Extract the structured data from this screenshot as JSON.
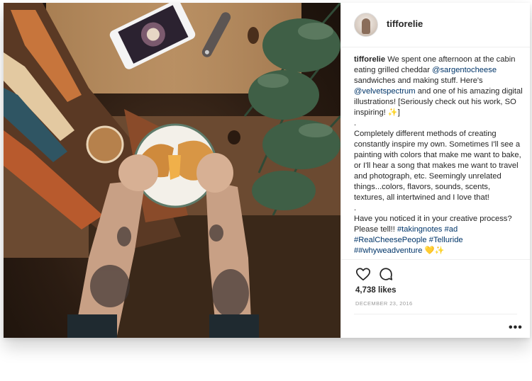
{
  "post": {
    "username": "tifforelie",
    "caption": {
      "username": "tifforelie",
      "seg1": " We spent one afternoon at the cabin eating grilled cheddar ",
      "mention1": "@sargentocheese",
      "seg2": " sandwiches and making stuff. Here's ",
      "mention2": "@velvetspectrum",
      "seg3": " and one of his amazing digital illustrations! [Seriously check out his work, SO inspiring! ✨]",
      "dot1": ".",
      "para2": "Completely different methods of creating constantly inspire my own. Sometimes I'll see a painting with colors that make me want to bake, or I'll hear a song that makes me want to travel and photograph, etc. Seemingly unrelated things...colors, flavors, sounds, scents, textures, all intertwined and I love that!",
      "dot2": ".",
      "para3": "Have you noticed it in your creative process? Please tell!! ",
      "tag1": "#takingnotes",
      "tag2": "#ad",
      "tag3": "#RealCheesePeople",
      "tag4": "#Telluride",
      "tag5": "#whyweadventure",
      "tag5_prefix": "#",
      "emoji_end": "💛✨"
    },
    "likes": "4,738 likes",
    "date": "DECEMBER 23, 2016",
    "more_label": "•••"
  },
  "icons": {
    "like": "heart-icon",
    "comment": "comment-icon"
  },
  "colors": {
    "text": "#262626",
    "link": "#003569",
    "muted": "#999999",
    "divider": "#efefef"
  }
}
